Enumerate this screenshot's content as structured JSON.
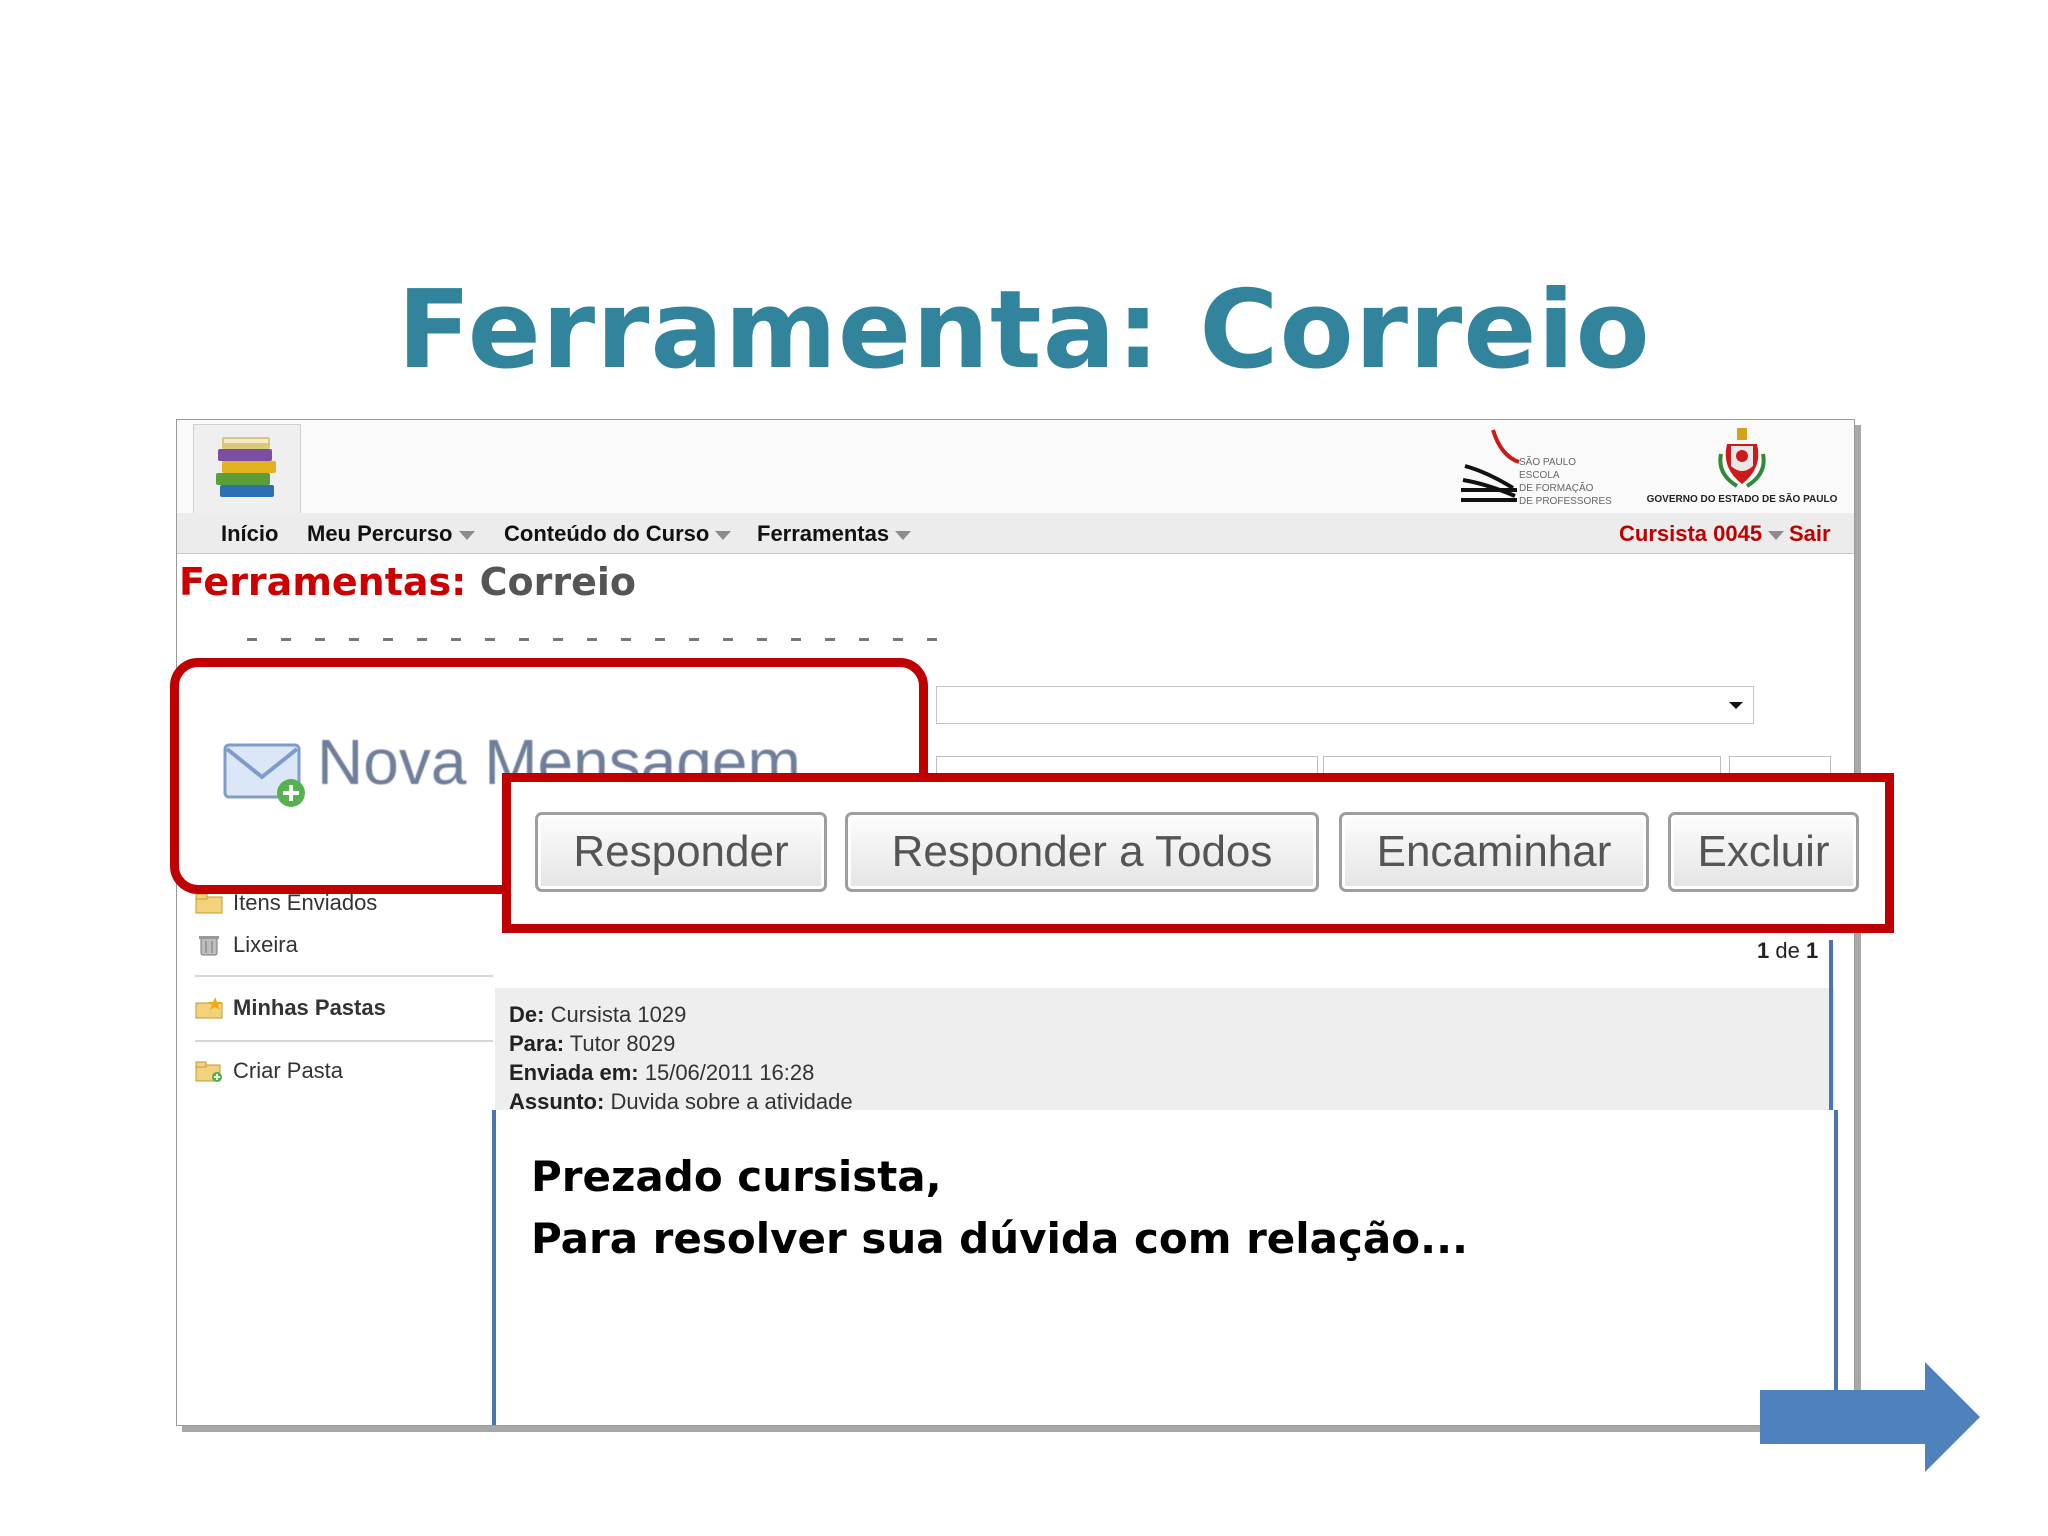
{
  "slide": {
    "title": "Ferramenta: Correio"
  },
  "navbar": {
    "items": [
      "Início",
      "Meu Percurso",
      "Conteúdo do Curso",
      "Ferramentas"
    ],
    "user": "Cursista 0045",
    "logout": "Sair"
  },
  "header": {
    "logo_school_lines": [
      "SÃO PAULO ESCOLA",
      "DE FORMAÇÃO",
      "DE PROFESSORES"
    ],
    "logo_gov": "GOVERNO DO ESTADO DE SÃO PAULO"
  },
  "page": {
    "title_red": "Ferramentas:",
    "title_grey": "Correio"
  },
  "callout_new": {
    "label": "Nova Mensagem"
  },
  "actions": {
    "reply": "Responder",
    "reply_all": "Responder a Todos",
    "forward": "Encaminhar",
    "delete": "Excluir"
  },
  "sidebar": {
    "sent": "Itens Enviados",
    "trash": "Lixeira",
    "my_folders": "Minhas Pastas",
    "create_folder": "Criar Pasta"
  },
  "pager": {
    "current": "1",
    "of": "de",
    "total": "1"
  },
  "message": {
    "from_label": "De:",
    "from": "Cursista 1029",
    "to_label": "Para:",
    "to": "Tutor 8029",
    "sent_label": "Enviada em:",
    "sent": "15/06/2011 16:28",
    "subject_label": "Assunto:",
    "subject": "Duvida sobre a atividade",
    "body_line1": "Prezado cursista,",
    "body_line2": "Para resolver sua dúvida com relação..."
  },
  "colors": {
    "title": "#31849B",
    "callout": "#C00000",
    "accent_red": "#CC0000",
    "message_border": "#4A72B5",
    "arrow": "#4F81BD"
  }
}
